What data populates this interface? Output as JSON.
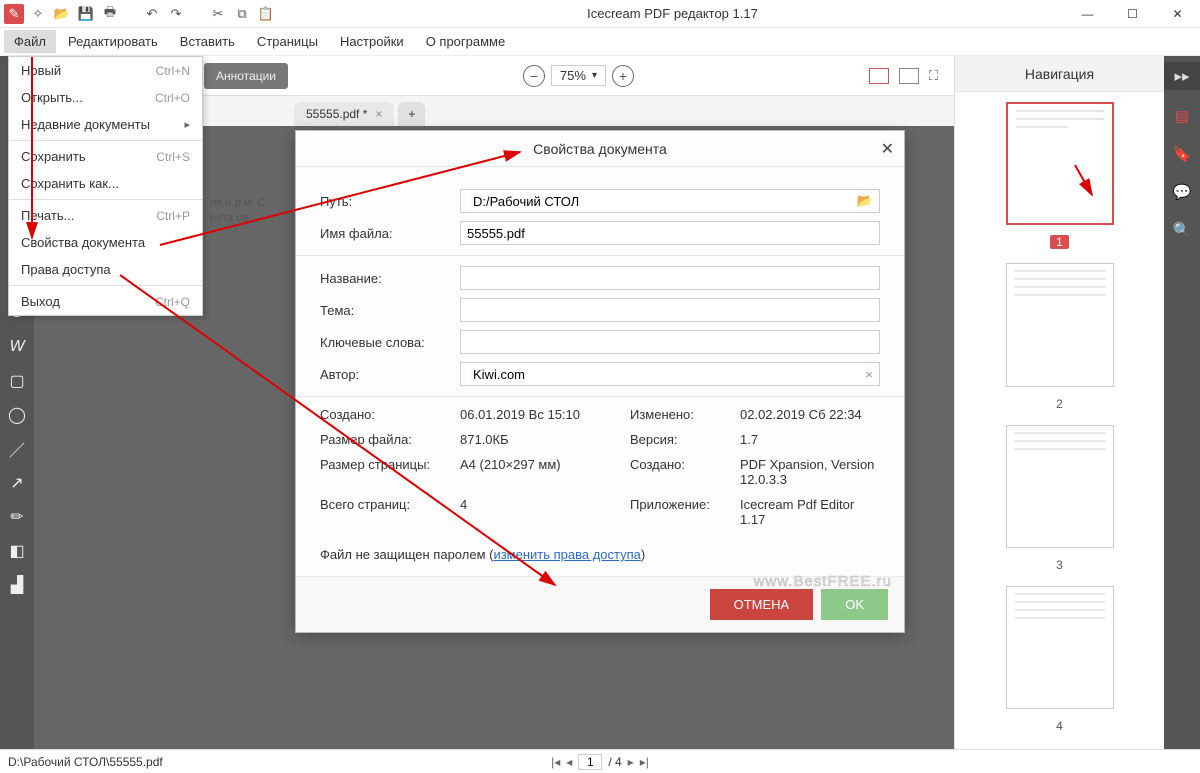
{
  "title": "Icecream PDF редактор 1.17",
  "menubar": [
    "Файл",
    "Редактировать",
    "Вставить",
    "Страницы",
    "Настройки",
    "О программе"
  ],
  "tab_annot": "Аннотации",
  "zoom": "75%",
  "doc_tab": "55555.pdf *",
  "nav_title": "Навигация",
  "thumbs": [
    "1",
    "2",
    "3",
    "4"
  ],
  "status_path": "D:\\Рабочий СТОЛ\\55555.pdf",
  "pager": {
    "current": "1",
    "total": "4"
  },
  "dropdown": [
    {
      "label": "Новый",
      "sc": "Ctrl+N"
    },
    {
      "label": "Открыть...",
      "sc": "Ctrl+O"
    },
    {
      "label": "Недавние документы",
      "sub": true
    },
    {
      "sep": true
    },
    {
      "label": "Сохранить",
      "sc": "Ctrl+S"
    },
    {
      "label": "Сохранить как..."
    },
    {
      "sep": true
    },
    {
      "label": "Печать...",
      "sc": "Ctrl+P"
    },
    {
      "label": "Свойства документа"
    },
    {
      "label": "Права доступа"
    },
    {
      "sep": true
    },
    {
      "label": "Выход",
      "sc": "Ctrl+Q"
    }
  ],
  "dialog": {
    "title": "Свойства документа",
    "path_lbl": "Путь:",
    "path_val": "D:/Рабочий СТОЛ",
    "file_lbl": "Имя файла:",
    "file_val": "55555.pdf",
    "name_lbl": "Название:",
    "name_val": "",
    "subj_lbl": "Тема:",
    "subj_val": "",
    "kw_lbl": "Ключевые слова:",
    "kw_val": "",
    "auth_lbl": "Автор:",
    "auth_val": "Kiwi.com",
    "cr_lbl": "Создано:",
    "cr_val": "06.01.2019 Вс 15:10",
    "mod_lbl": "Изменено:",
    "mod_val": "02.02.2019 Сб 22:34",
    "size_lbl": "Размер файла:",
    "size_val": "871.0КБ",
    "ver_lbl": "Версия:",
    "ver_val": "1.7",
    "psize_lbl": "Размер страницы:",
    "psize_val": "A4 (210×297 мм)",
    "creator_lbl": "Создано:",
    "creator_val": "PDF Xpansion, Version 12.0.3.3",
    "pages_lbl": "Всего страниц:",
    "pages_val": "4",
    "app_lbl": "Приложение:",
    "app_val": "Icecream Pdf Editor 1.17",
    "note_pre": "Файл не защищен паролем (",
    "note_link": "изменить права доступа",
    "note_post": ")",
    "cancel": "ОТМЕНА",
    "ok": "OK"
  },
  "hidden_frag": "ля и р м. С ента ов",
  "watermark": "www.BestFREE.ru"
}
